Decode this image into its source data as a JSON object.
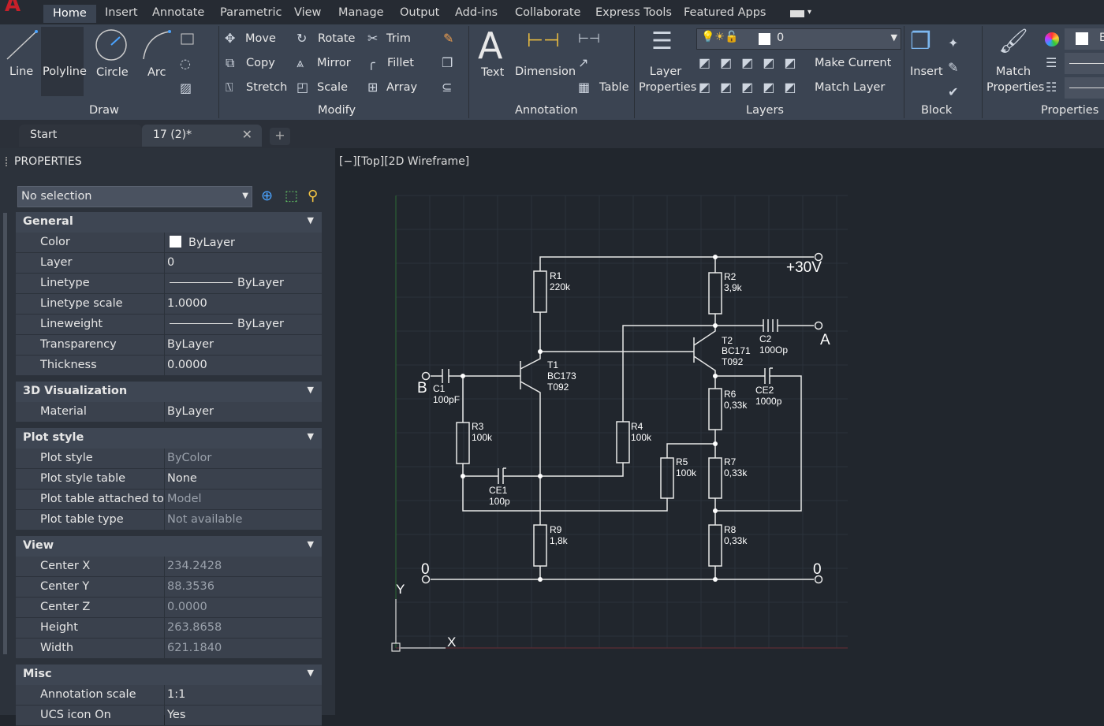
{
  "menu": [
    "Home",
    "Insert",
    "Annotate",
    "Parametric",
    "View",
    "Manage",
    "Output",
    "Add-ins",
    "Collaborate",
    "Express Tools",
    "Featured Apps"
  ],
  "ribbon": {
    "draw": {
      "line": "Line",
      "polyline": "Polyline",
      "circle": "Circle",
      "arc": "Arc",
      "group": "Draw"
    },
    "modify": {
      "move": "Move",
      "rotate": "Rotate",
      "trim": "Trim",
      "copy": "Copy",
      "mirror": "Mirror",
      "fillet": "Fillet",
      "stretch": "Stretch",
      "scale": "Scale",
      "array": "Array",
      "group": "Modify"
    },
    "annotation": {
      "text": "Text",
      "dimension": "Dimension",
      "table": "Table",
      "group": "Annotation"
    },
    "layers": {
      "layer_properties": "Layer Properties",
      "current_layer": "0",
      "make_current": "Make Current",
      "match_layer": "Match Layer",
      "group": "Layers"
    },
    "block": {
      "insert": "Insert",
      "group": "Block"
    },
    "properties": {
      "match": "Match Properties",
      "group": "Properties",
      "color_value": "B"
    }
  },
  "tabs": {
    "start": "Start",
    "doc": "17 (2)*"
  },
  "panel": {
    "title": "PROPERTIES",
    "selection": "No selection",
    "sections": [
      {
        "title": "General",
        "rows": [
          [
            "Color",
            "ByLayer"
          ],
          [
            "Layer",
            "0"
          ],
          [
            "Linetype",
            "ByLayer"
          ],
          [
            "Linetype scale",
            "1.0000"
          ],
          [
            "Lineweight",
            "ByLayer"
          ],
          [
            "Transparency",
            "ByLayer"
          ],
          [
            "Thickness",
            "0.0000"
          ]
        ]
      },
      {
        "title": "3D Visualization",
        "rows": [
          [
            "Material",
            "ByLayer"
          ]
        ]
      },
      {
        "title": "Plot style",
        "rows": [
          [
            "Plot style",
            "ByColor",
            1
          ],
          [
            "Plot style table",
            "None"
          ],
          [
            "Plot table attached to",
            "Model",
            1
          ],
          [
            "Plot table type",
            "Not available",
            1
          ]
        ]
      },
      {
        "title": "View",
        "rows": [
          [
            "Center X",
            "234.2428",
            1
          ],
          [
            "Center Y",
            "88.3536",
            1
          ],
          [
            "Center Z",
            "0.0000",
            1
          ],
          [
            "Height",
            "263.8658",
            1
          ],
          [
            "Width",
            "621.1840",
            1
          ]
        ]
      },
      {
        "title": "Misc",
        "rows": [
          [
            "Annotation scale",
            "1:1"
          ],
          [
            "UCS icon On",
            "Yes"
          ]
        ]
      }
    ]
  },
  "viewport": {
    "label": "[−][Top][2D Wireframe]"
  },
  "schematic": {
    "vplus": "+30V",
    "a": "A",
    "b": "B",
    "gnd_l": "0",
    "gnd_r": "0",
    "parts": [
      [
        "R1",
        "220k"
      ],
      [
        "R2",
        "3,9k"
      ],
      [
        "R3",
        "100k"
      ],
      [
        "R4",
        "100k"
      ],
      [
        "R5",
        "100k"
      ],
      [
        "R6",
        "0,33k"
      ],
      [
        "R7",
        "0,33k"
      ],
      [
        "R8",
        "0,33k"
      ],
      [
        "R9",
        "1,8k"
      ],
      [
        "C1",
        "100pF"
      ],
      [
        "C2",
        "100Op"
      ],
      [
        "CE1",
        "100p"
      ],
      [
        "CE2",
        "1000p"
      ]
    ],
    "t1": [
      "T1",
      "BC173",
      "T092"
    ],
    "t2": [
      "T2",
      "BC171",
      "T092"
    ]
  },
  "ucs": {
    "x": "X",
    "y": "Y"
  }
}
